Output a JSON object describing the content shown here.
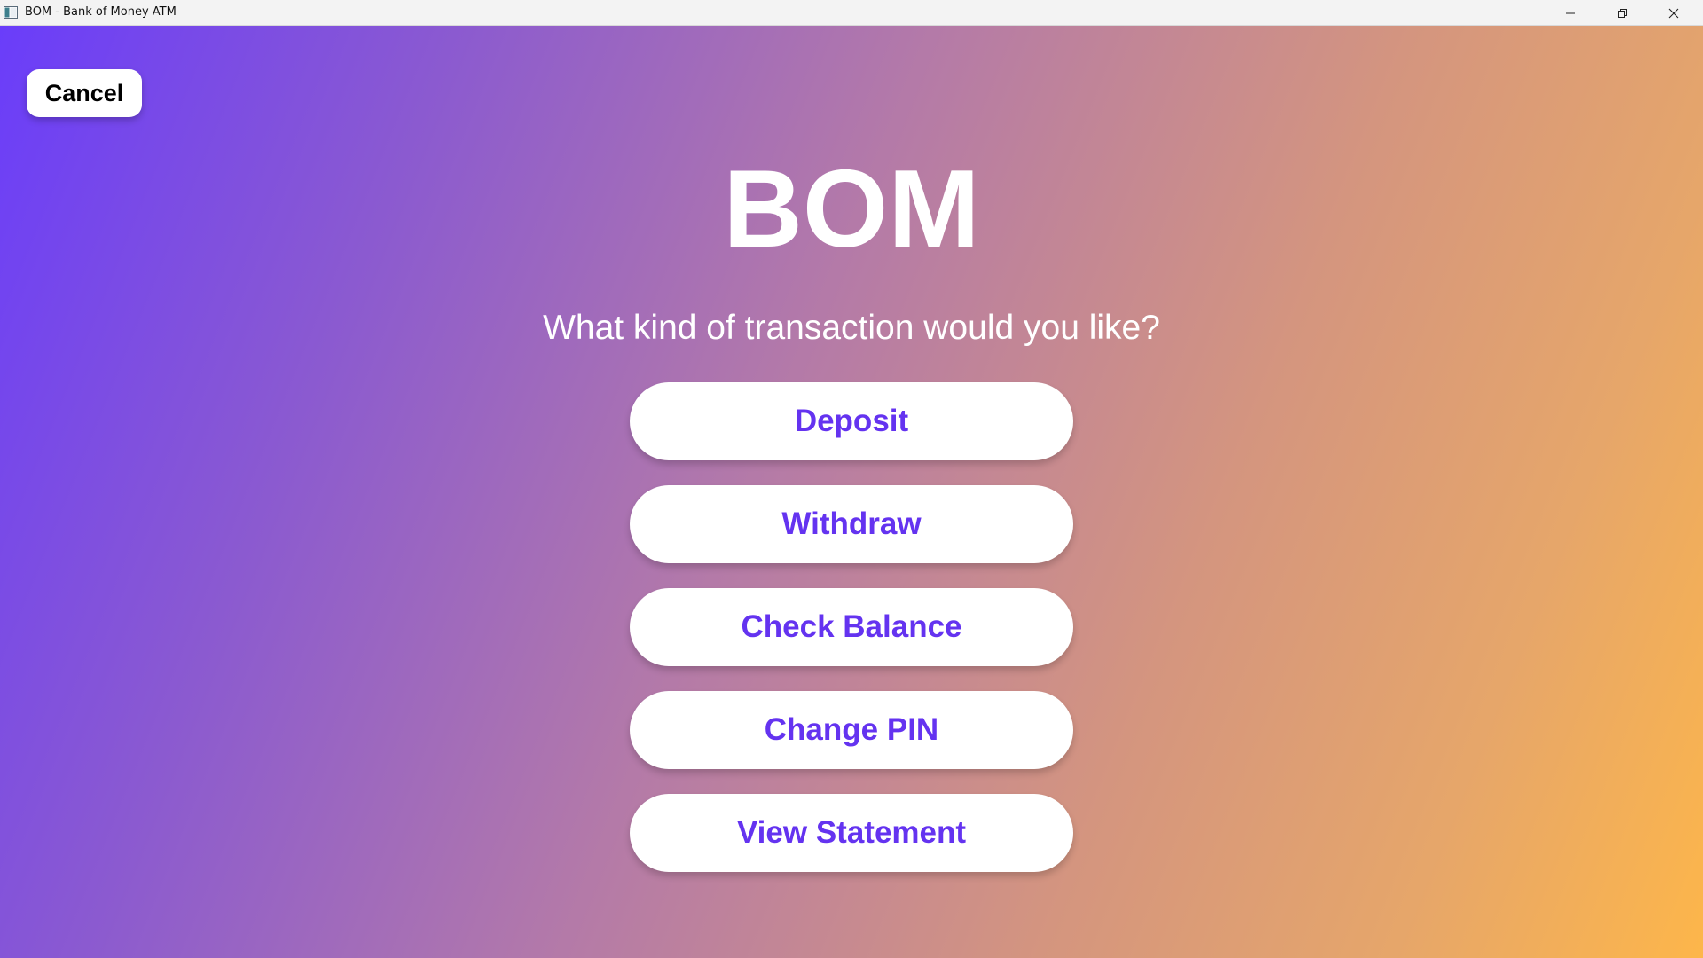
{
  "window": {
    "title": "BOM - Bank of Money ATM",
    "icon": "app-window-icon",
    "controls": {
      "minimize_icon": "minimize-icon",
      "restore_icon": "restore-icon",
      "close_icon": "close-icon"
    }
  },
  "screen": {
    "cancel_label": "Cancel",
    "brand": "BOM",
    "prompt": "What kind of transaction would you like?",
    "options": [
      {
        "label": "Deposit"
      },
      {
        "label": "Withdraw"
      },
      {
        "label": "Check Balance"
      },
      {
        "label": "Change PIN"
      },
      {
        "label": "View Statement"
      }
    ]
  },
  "colors": {
    "gradient_start": "#6a3dfa",
    "gradient_end": "#fdb64a",
    "button_text": "#6433f0",
    "button_bg": "#ffffff"
  }
}
